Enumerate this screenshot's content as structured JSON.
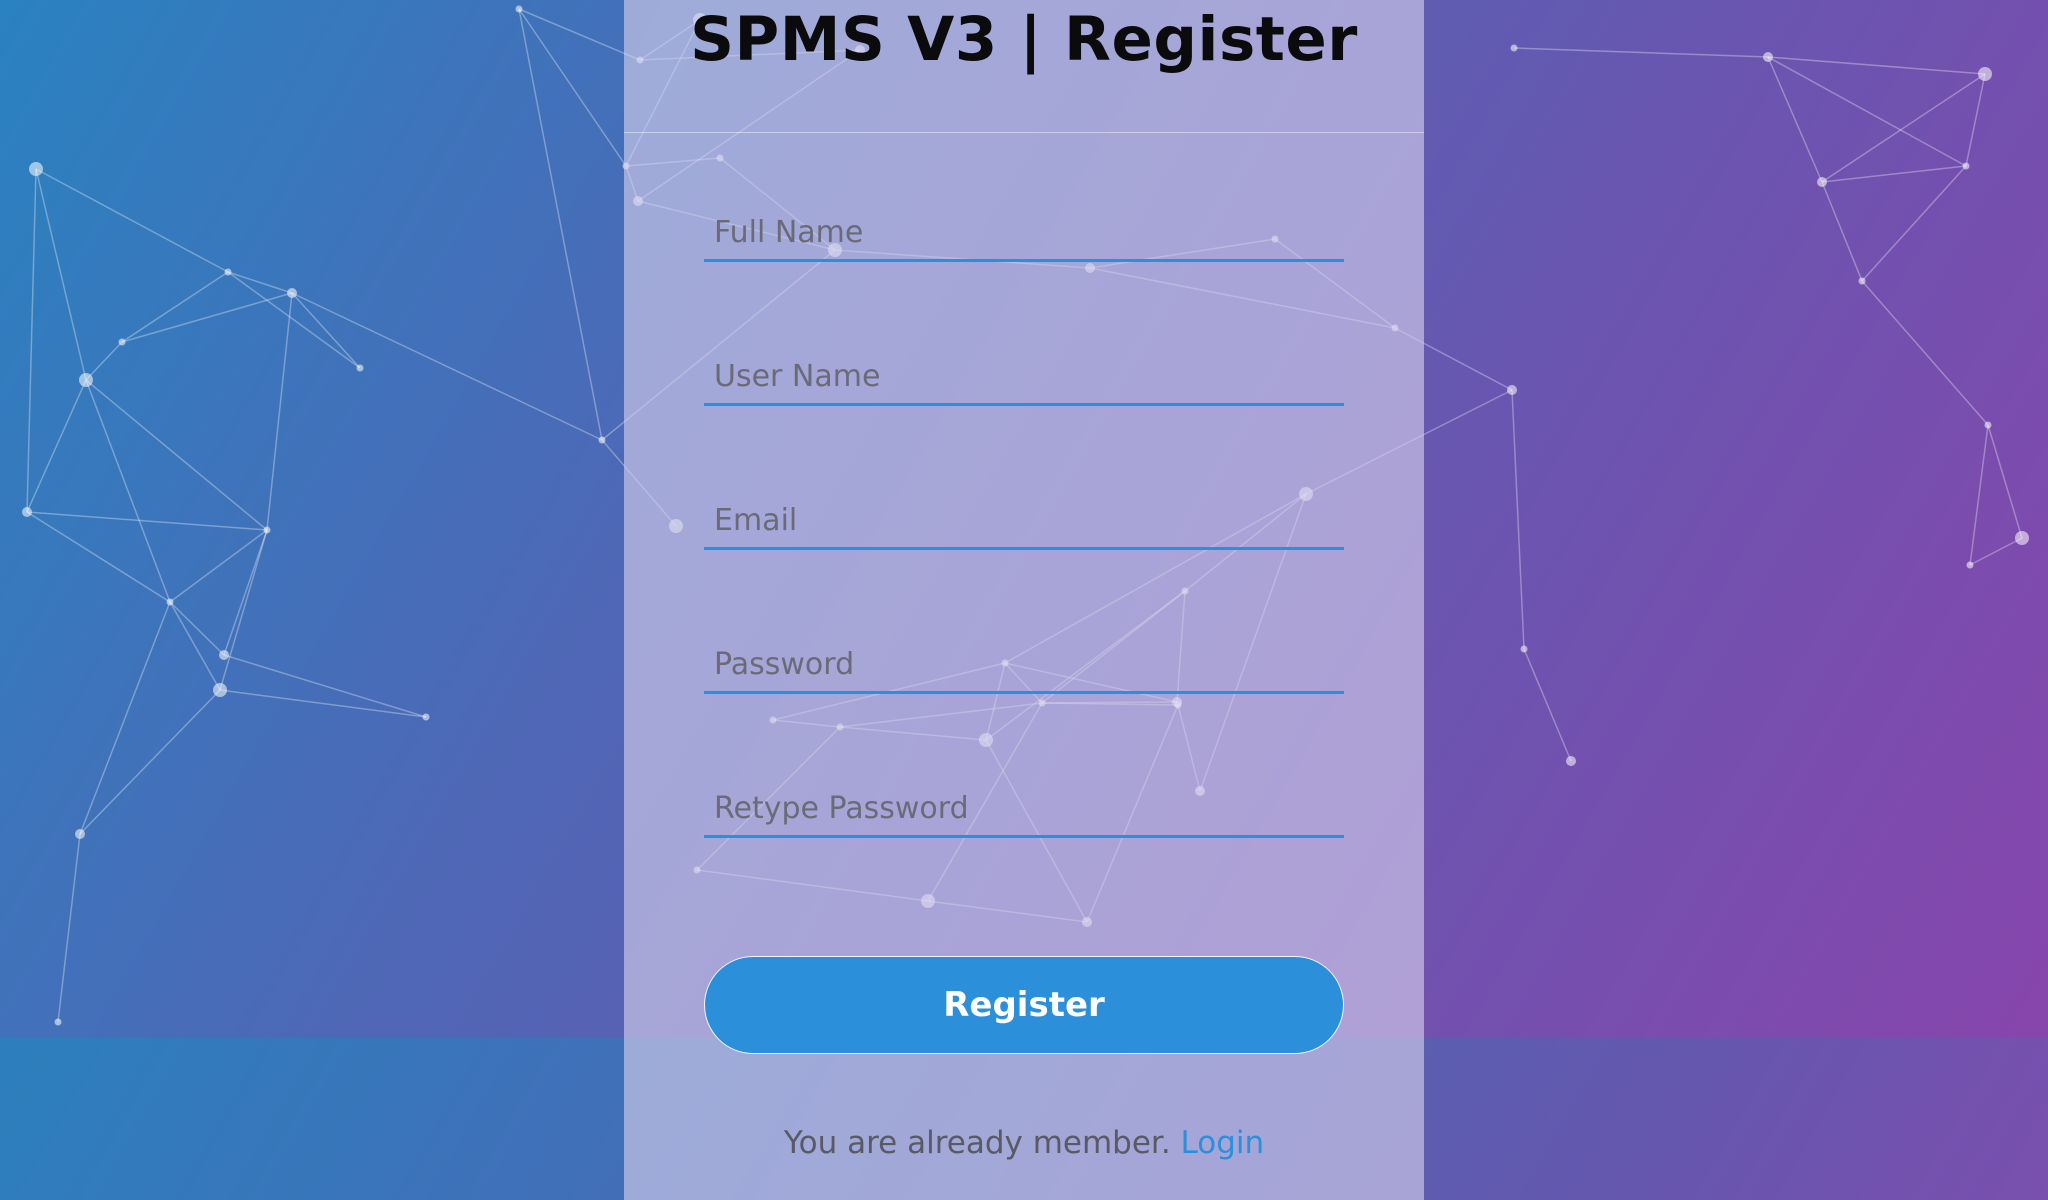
{
  "app": {
    "title": "SPMS V3 | Register"
  },
  "form": {
    "full_name_placeholder": "Full Name",
    "user_name_placeholder": "User Name",
    "email_placeholder": "Email",
    "password_placeholder": "Password",
    "retype_password_placeholder": "Retype Password",
    "register_label": "Register"
  },
  "footer": {
    "text": "You are already member. ",
    "login_label": "Login"
  },
  "colors": {
    "accent": "#2b8fd9",
    "gradient_start": "#2a82c0",
    "gradient_end": "#8a44ac",
    "title_text": "#0b0b0d",
    "muted_text": "#5a5a64"
  }
}
